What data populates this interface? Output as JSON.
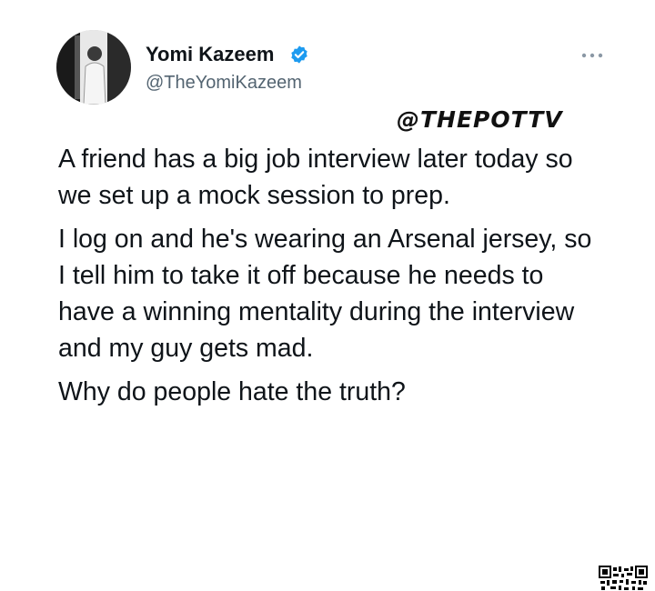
{
  "tweet": {
    "author": {
      "name": "Yomi Kazeem",
      "handle": "@TheYomiKazeem",
      "verified": true,
      "avatar_icon": "profile-photo",
      "verified_icon": "verified-badge-icon",
      "verified_color": "#1d9bf0"
    },
    "more_icon": "more-options-icon",
    "watermark": "@THEPOTTV",
    "paragraphs": [
      "A friend has a big job interview later today so we set up a mock session to prep.",
      "I log on and he's wearing an Arsenal jersey, so I tell him to take it off because he needs to have a winning mentality during the interview and my guy gets mad.",
      "Why do people hate the truth?"
    ],
    "qr_icon": "qr-code-icon"
  }
}
